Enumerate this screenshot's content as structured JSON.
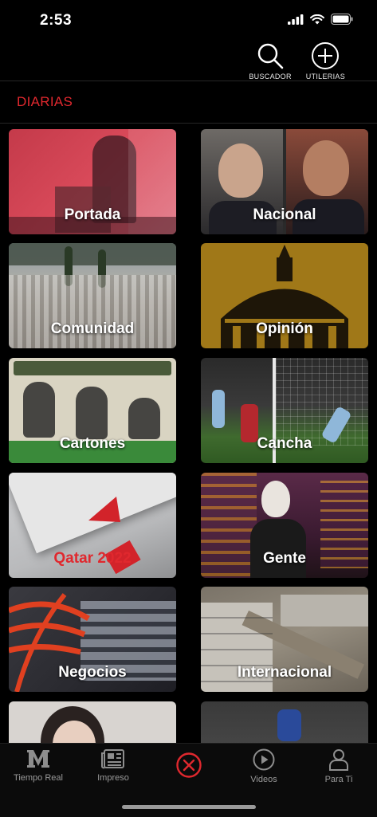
{
  "status": {
    "time": "2:53"
  },
  "header": {
    "search_label": "BUSCADOR",
    "tools_label": "UTILERIAS"
  },
  "section": {
    "title": "DIARIAS"
  },
  "tiles": [
    {
      "label": "Portada"
    },
    {
      "label": "Nacional"
    },
    {
      "label": "Comunidad"
    },
    {
      "label": "Opinión"
    },
    {
      "label": "Cartones"
    },
    {
      "label": "Cancha"
    },
    {
      "label": "Qatar 2022"
    },
    {
      "label": "Gente"
    },
    {
      "label": "Negocios"
    },
    {
      "label": "Internacional"
    },
    {
      "label": ""
    },
    {
      "label": ""
    }
  ],
  "tabbar": {
    "items": [
      {
        "label": "Tiempo Real",
        "icon": "m-logo-icon"
      },
      {
        "label": "Impreso",
        "icon": "newspaper-icon"
      },
      {
        "label": "",
        "icon": "close-circle-icon"
      },
      {
        "label": "Videos",
        "icon": "play-circle-icon"
      },
      {
        "label": "Para Ti",
        "icon": "user-icon"
      }
    ]
  },
  "colors": {
    "accent": "#e0282e",
    "background": "#000000"
  }
}
